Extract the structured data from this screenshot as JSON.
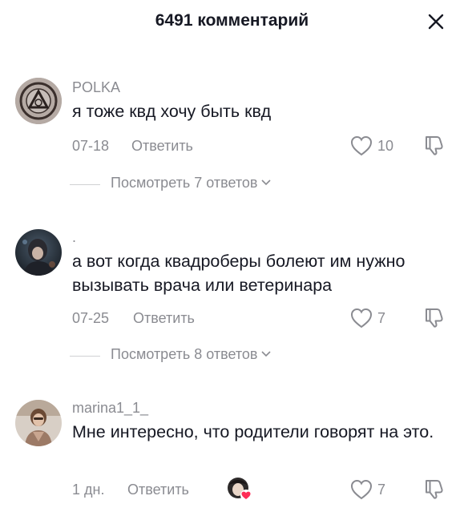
{
  "header": {
    "title": "6491 комментарий"
  },
  "comments": [
    {
      "username": "POLKA",
      "text": "я тоже квд хочу быть квд",
      "date": "07-18",
      "reply_label": "Ответить",
      "likes": "10",
      "view_replies": "Посмотреть 7 ответов"
    },
    {
      "username": ".",
      "text": "а вот когда квадроберы болеют им нужно вызывать врача или ветеринара",
      "date": "07-25",
      "reply_label": "Ответить",
      "likes": "7",
      "view_replies": "Посмотреть 8 ответов"
    },
    {
      "username": "marina1_1_",
      "text": "Мне интересно, что родители говорят на это.",
      "date": "1 дн.",
      "reply_label": "Ответить",
      "likes": "7"
    }
  ],
  "colors": {
    "text": "#161823",
    "secondary": "#8a8b91",
    "heart_badge": "#fe2c55"
  }
}
